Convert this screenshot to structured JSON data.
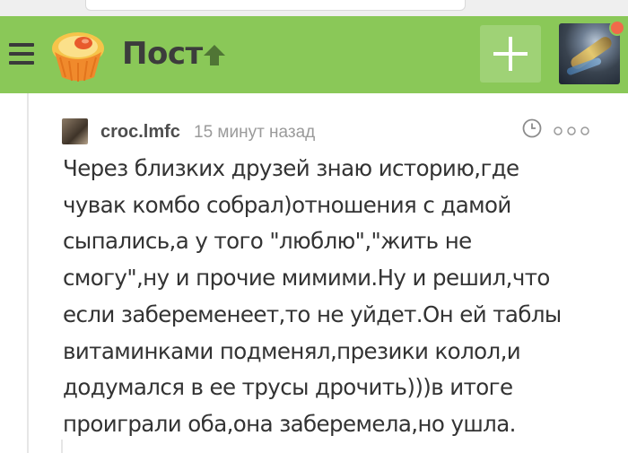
{
  "header": {
    "title": "Пост",
    "accent_color": "#8ac858"
  },
  "icons": {
    "menu": "hamburger-menu-icon",
    "logo": "cupcake-logo-icon",
    "up": "arrow-up-icon",
    "add": "plus-icon",
    "clock": "clock-icon",
    "more": "more-dots-icon"
  },
  "comment": {
    "author": "croc.lmfc",
    "time": "15 минут назад",
    "text": "Через близких друзей знаю историю,где\nчувак комбо собрал)отношения с дамой\nсыпались,а у того \"люблю\",\"жить не\nсмогу\",ну и прочие мимими.Ну и решил,что\nесли забеременеет,то не уйдет.Он ей таблы\nвитаминками подменял,презики колол,и\nдодумался в ее трусы дрочить)))в итоге\nпроиграли оба,она заберемела,но ушла."
  }
}
